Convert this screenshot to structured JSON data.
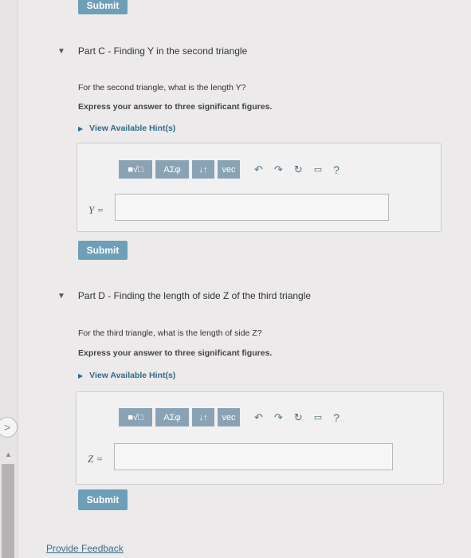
{
  "top_submit": "Submit",
  "part_c": {
    "header": "Part C - Finding Y in the second triangle",
    "question": "For the second triangle, what is the length Y?",
    "instruction": "Express your answer to three significant figures.",
    "hint": "View Available Hint(s)",
    "answer_label": "Y =",
    "answer_value": "",
    "submit": "Submit"
  },
  "part_d": {
    "header": "Part D - Finding the length of side Z of the third triangle",
    "question": "For the third triangle, what is the length of side Z?",
    "instruction": "Express your answer to three significant figures.",
    "hint": "View Available Hint(s)",
    "answer_label": "Z =",
    "answer_value": "",
    "submit": "Submit"
  },
  "toolbar": {
    "templates": "■√□",
    "greek": "ΑΣφ",
    "arrows": "↓↑",
    "vec": "vec",
    "help": "?"
  },
  "feedback": "Provide Feedback",
  "rail_toggle": ">",
  "icons": [
    "undo-icon",
    "redo-icon",
    "reset-icon",
    "keyboard-icon",
    "help-icon"
  ]
}
